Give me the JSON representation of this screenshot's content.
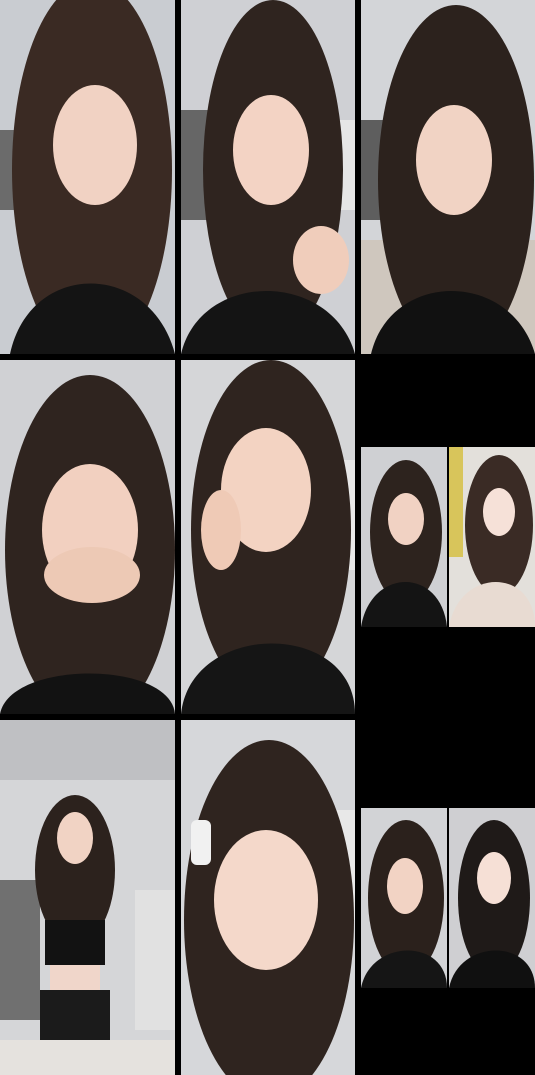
{
  "tiles": [
    {
      "id": "r1c1",
      "scene": "room-wall",
      "pose": "talking"
    },
    {
      "id": "r1c2",
      "scene": "room-rack",
      "pose": "laughing-hand-raised"
    },
    {
      "id": "r1c3",
      "scene": "room-corner",
      "pose": "eyes-closed-smile"
    },
    {
      "id": "r2c1",
      "scene": "room-wall",
      "pose": "hand-over-mouth"
    },
    {
      "id": "r2c2",
      "scene": "room-shelf",
      "pose": "cheek-on-hand"
    },
    {
      "id": "r2c3a",
      "scene": "split-left",
      "pose": "neutral"
    },
    {
      "id": "r2c3b",
      "scene": "split-right",
      "pose": "neutral-light-top"
    },
    {
      "id": "r3c1",
      "scene": "room-full-body",
      "pose": "arm-raised-standing"
    },
    {
      "id": "r3c2",
      "scene": "room-shelf",
      "pose": "close-up-hairclip"
    },
    {
      "id": "r3c3a",
      "scene": "split-left",
      "pose": "head-tilt"
    },
    {
      "id": "r3c3b",
      "scene": "split-right",
      "pose": "headset-smile"
    }
  ]
}
